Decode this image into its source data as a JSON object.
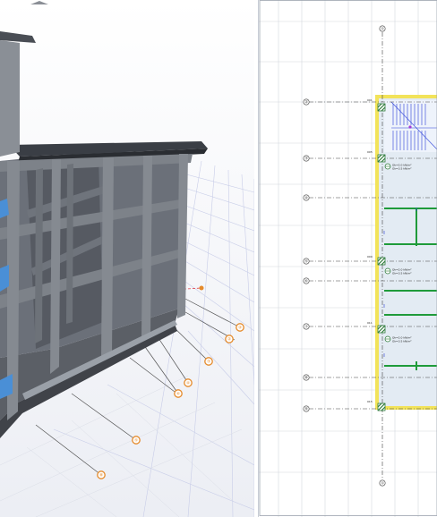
{
  "viewport_3d": {
    "grid_markers": [
      "②",
      "②",
      "③",
      "④",
      "⑥",
      "⑤",
      "⑧",
      "⑨"
    ],
    "colors": {
      "concrete": "#7d8289",
      "slab_dark": "#3a3e45",
      "stair_blue": "#4a8fd6",
      "floor_grid": "#c8cde8",
      "marker": "#e58a2a"
    }
  },
  "plan_view": {
    "grid_bubbles": [
      "①",
      "②",
      "③",
      "④",
      "⑤",
      "⑥",
      "⑦",
      "⑧",
      "⑨"
    ],
    "column_tags": [
      "001",
      "005",
      "009",
      "011",
      "015"
    ],
    "load_labels": [
      "Qk=2.0 kN/m²",
      "Gk=3.5 kN/m²"
    ],
    "colors": {
      "beam_green": "#1f9b3a",
      "slab_fill": "#e3ebf3",
      "wall_yellow": "#f2e35a",
      "stair_blue": "#2a3fd8",
      "hatch": "#2f7b3c"
    }
  }
}
